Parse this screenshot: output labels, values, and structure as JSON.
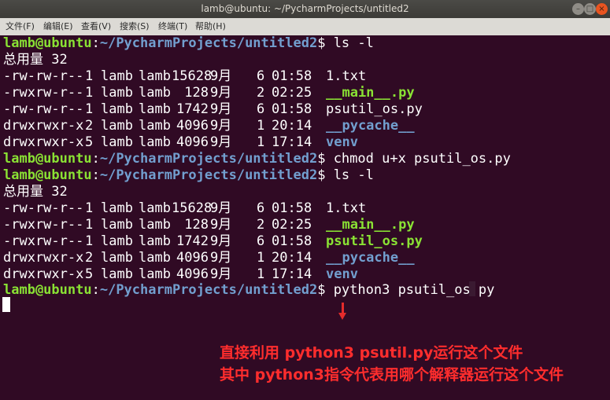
{
  "window": {
    "title": "lamb@ubuntu: ~/PycharmProjects/untitled2",
    "buttons": {
      "minimize": "–",
      "maximize": "□",
      "close": "×"
    }
  },
  "menu": [
    "文件(F)",
    "编辑(E)",
    "查看(V)",
    "搜索(S)",
    "终端(T)",
    "帮助(H)"
  ],
  "prompt": {
    "user": "lamb@ubuntu",
    "path": "~/PycharmProjects/untitled2",
    "symbol": "$"
  },
  "commands": {
    "ls": "ls -l",
    "chmod": "chmod u+x psutil_os.py",
    "run": "python3 psutil_os.py"
  },
  "total": "总用量 32",
  "listing1": [
    {
      "perm": "-rw-rw-r--",
      "links": "1",
      "owner": "lamb",
      "group": "lamb",
      "size": "15628",
      "month": "9月",
      "day": "6",
      "time": "01:58",
      "name": "1.txt",
      "type": "file"
    },
    {
      "perm": "-rwxrw-r--",
      "links": "1",
      "owner": "lamb",
      "group": "lamb",
      "size": "128",
      "month": "9月",
      "day": "2",
      "time": "02:25",
      "name": "__main__.py",
      "type": "exec"
    },
    {
      "perm": "-rw-rw-r--",
      "links": "1",
      "owner": "lamb",
      "group": "lamb",
      "size": "1742",
      "month": "9月",
      "day": "6",
      "time": "01:58",
      "name": "psutil_os.py",
      "type": "file"
    },
    {
      "perm": "drwxrwxr-x",
      "links": "2",
      "owner": "lamb",
      "group": "lamb",
      "size": "4096",
      "month": "9月",
      "day": "1",
      "time": "20:14",
      "name": "__pycache__",
      "type": "dir"
    },
    {
      "perm": "drwxrwxr-x",
      "links": "5",
      "owner": "lamb",
      "group": "lamb",
      "size": "4096",
      "month": "9月",
      "day": "1",
      "time": "17:14",
      "name": "venv",
      "type": "dir"
    }
  ],
  "listing2": [
    {
      "perm": "-rw-rw-r--",
      "links": "1",
      "owner": "lamb",
      "group": "lamb",
      "size": "15628",
      "month": "9月",
      "day": "6",
      "time": "01:58",
      "name": "1.txt",
      "type": "file"
    },
    {
      "perm": "-rwxrw-r--",
      "links": "1",
      "owner": "lamb",
      "group": "lamb",
      "size": "128",
      "month": "9月",
      "day": "2",
      "time": "02:25",
      "name": "__main__.py",
      "type": "exec"
    },
    {
      "perm": "-rwxrw-r--",
      "links": "1",
      "owner": "lamb",
      "group": "lamb",
      "size": "1742",
      "month": "9月",
      "day": "6",
      "time": "01:58",
      "name": "psutil_os.py",
      "type": "exec"
    },
    {
      "perm": "drwxrwxr-x",
      "links": "2",
      "owner": "lamb",
      "group": "lamb",
      "size": "4096",
      "month": "9月",
      "day": "1",
      "time": "20:14",
      "name": "__pycache__",
      "type": "dir"
    },
    {
      "perm": "drwxrwxr-x",
      "links": "5",
      "owner": "lamb",
      "group": "lamb",
      "size": "4096",
      "month": "9月",
      "day": "1",
      "time": "17:14",
      "name": "venv",
      "type": "dir"
    }
  ],
  "annotation": {
    "line1": "直接利用 python3 psutil.py运行这个文件",
    "line2": "其中 python3指令代表用哪个解释器运行这个文件",
    "color": "#ff2d2d"
  },
  "colors": {
    "background": "#300a24",
    "prompt_user": "#8ae234",
    "prompt_path": "#729fcf",
    "directory": "#729fcf",
    "executable": "#8ae234"
  }
}
